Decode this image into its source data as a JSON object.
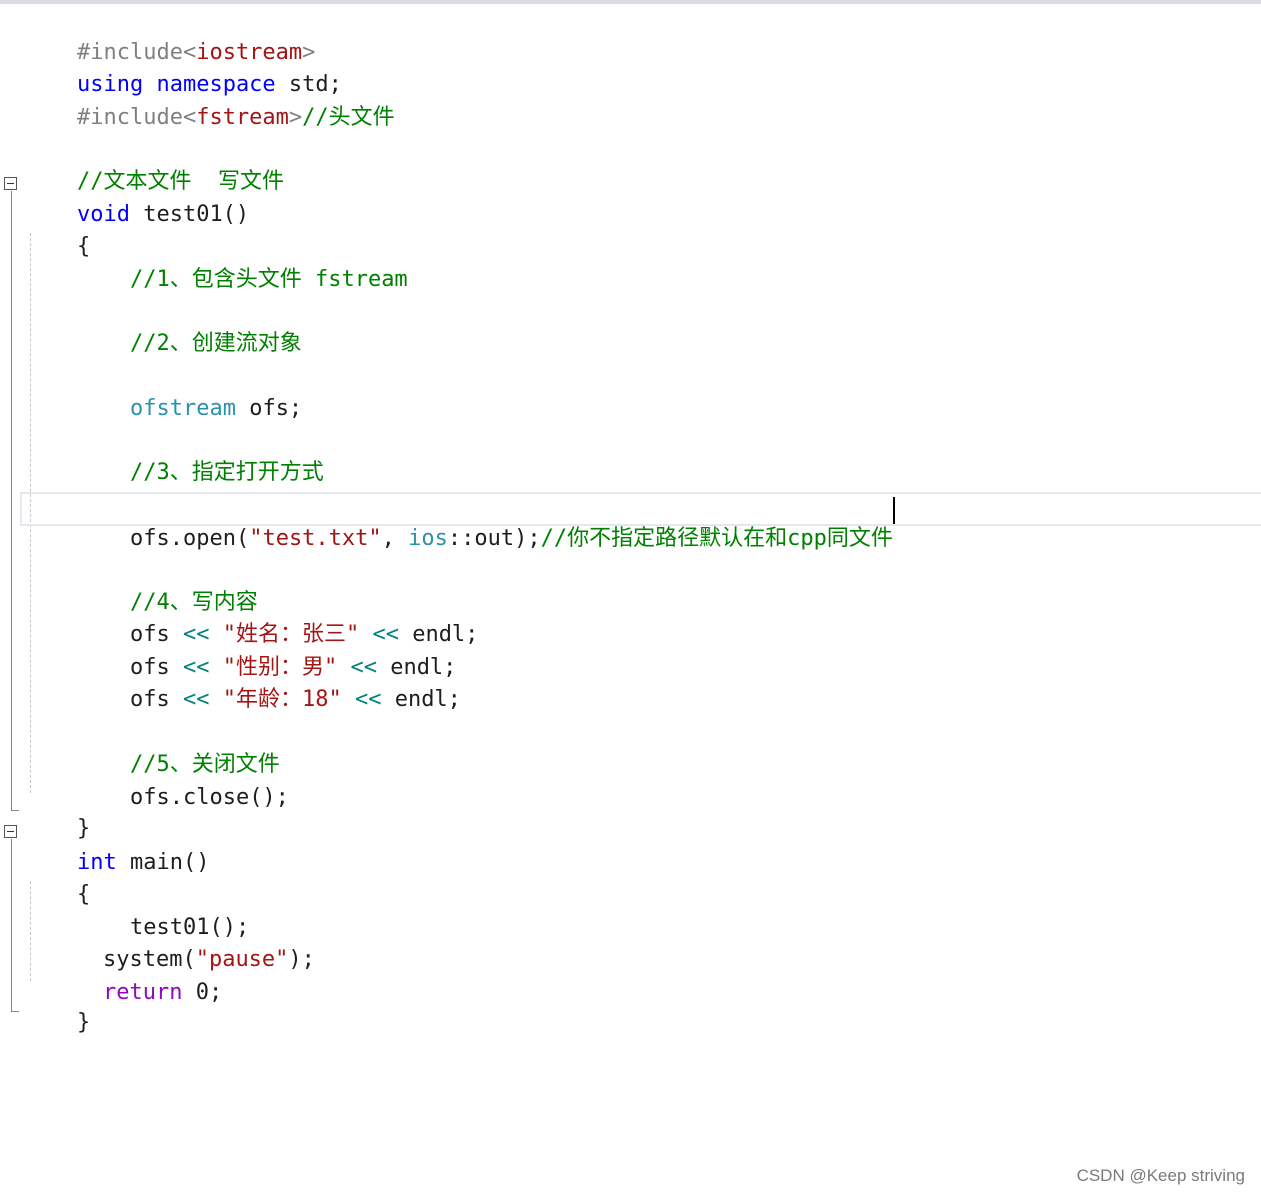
{
  "code": {
    "l1": {
      "directive": "#include",
      "lt": "<",
      "header": "iostream",
      "gt": ">"
    },
    "l2": {
      "using": "using",
      "namespace": "namespace",
      "rest": " std;"
    },
    "l3": {
      "directive": "#include",
      "lt": "<",
      "header": "fstream",
      "gt": ">",
      "comment": "//头文件"
    },
    "l5": {
      "comment": "//文本文件  写文件"
    },
    "l6": {
      "kw": "void",
      "rest": " test01()"
    },
    "l7": {
      "text": "{"
    },
    "l8": {
      "comment": "//1、包含头文件 fstream"
    },
    "l10": {
      "comment": "//2、创建流对象"
    },
    "l12": {
      "type": "ofstream",
      "rest": " ofs;"
    },
    "l14": {
      "comment": "//3、指定打开方式"
    },
    "l16": {
      "a": "ofs.open(",
      "str": "\"test.txt\"",
      "b": ", ",
      "type": "ios",
      "c": "::out);",
      "comment": "//你不指定路径默认在和cpp同文件"
    },
    "l18": {
      "comment": "//4、写内容"
    },
    "l19": {
      "a": "ofs ",
      "op": "<<",
      "str": " \"姓名：张三\" ",
      "op2": "<<",
      "b": " endl;"
    },
    "l20": {
      "a": "ofs ",
      "op": "<<",
      "str": " \"性别：男\" ",
      "op2": "<<",
      "b": " endl;"
    },
    "l21": {
      "a": "ofs ",
      "op": "<<",
      "str": " \"年龄：18\" ",
      "op2": "<<",
      "b": " endl;"
    },
    "l23": {
      "comment": "//5、关闭文件"
    },
    "l24": {
      "text": "ofs.close();"
    },
    "l25": {
      "text": "}"
    },
    "l26": {
      "kw": "int",
      "rest": " main()"
    },
    "l27": {
      "text": "{"
    },
    "l28": {
      "text": "test01();"
    },
    "l29": {
      "a": "system(",
      "str": "\"pause\"",
      "b": ");"
    },
    "l30": {
      "kw": "return",
      "rest": " 0;"
    },
    "l31": {
      "text": "}"
    }
  },
  "watermark": "CSDN @Keep striving"
}
